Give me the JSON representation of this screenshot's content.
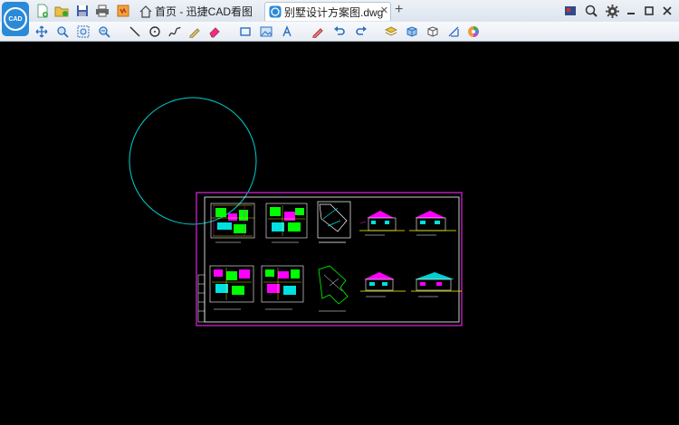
{
  "app": {
    "logo_text": "CAD",
    "name": "迅捷CAD看图"
  },
  "tabs": [
    {
      "label": "首页 - 迅捷CAD看图",
      "active": false
    },
    {
      "label": "别墅设计方案图.dwg",
      "active": true
    }
  ],
  "quick_actions": [
    "open-file-icon",
    "open-folder-icon",
    "save-icon",
    "print-icon",
    "convert-icon"
  ],
  "window_controls": [
    "screen-icon",
    "zoom-icon",
    "settings-icon",
    "minimize-icon",
    "maximize-icon",
    "close-icon"
  ],
  "tools": [
    "pan-icon",
    "zoom-window-icon",
    "zoom-extents-icon",
    "zoom-previous-icon",
    "line-icon",
    "circle-icon",
    "polyline-icon",
    "freehand-icon",
    "eraser-icon",
    "rectangle-icon",
    "insert-image-icon",
    "text-icon",
    "markup-icon",
    "undo-icon",
    "redo-icon",
    "layer-icon",
    "3d-view-icon",
    "3d-orbit-icon",
    "measure-icon",
    "color-wheel-icon"
  ],
  "colors": {
    "accent": "#2b8ad8",
    "canvas": "#000000",
    "frame": "#c020c0",
    "cyan": "#00d0d0",
    "green": "#00ff00"
  }
}
